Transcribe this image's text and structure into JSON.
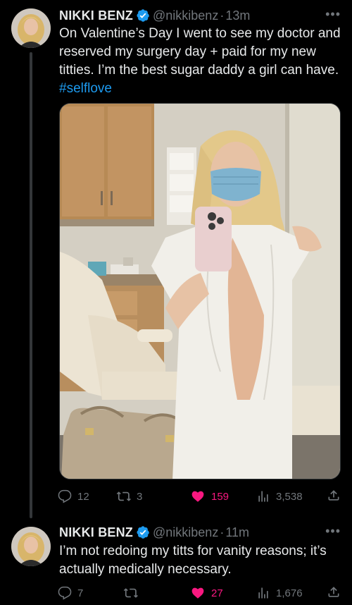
{
  "tweets": [
    {
      "author": {
        "display_name": "NIKKI BENZ",
        "handle": "@nikkibenz",
        "verified": true,
        "avatar": "profile-photo"
      },
      "separator": "·",
      "time": "13m",
      "text": "On Valentine’s Day I went to see my doctor and reserved my surgery day + paid for my new titties. I’m the best sugar daddy a girl can have. ",
      "hashtag": "#selflove",
      "media": "photo",
      "stats": {
        "replies": "12",
        "reposts": "3",
        "likes": "159",
        "views": "3,538"
      },
      "liked": true
    },
    {
      "author": {
        "display_name": "NIKKI BENZ",
        "handle": "@nikkibenz",
        "verified": true,
        "avatar": "profile-photo"
      },
      "separator": "·",
      "time": "11m",
      "text": "I’m not redoing my titts for vanity reasons; it’s actually medically necessary.",
      "stats": {
        "replies": "7",
        "reposts": "",
        "likes": "27",
        "views": "1,676"
      },
      "liked": true
    }
  ],
  "icons": {
    "more": "more-dots-icon",
    "verified": "verified-badge-icon",
    "reply": "reply-icon",
    "repost": "repost-icon",
    "like": "heart-icon",
    "views": "views-icon",
    "share": "share-icon"
  },
  "colors": {
    "background": "#000000",
    "text": "#e7e9ea",
    "secondary": "#71767b",
    "link": "#1d9bf0",
    "like": "#f91880",
    "verified": "#1d9bf0",
    "thread_line": "#333639"
  }
}
